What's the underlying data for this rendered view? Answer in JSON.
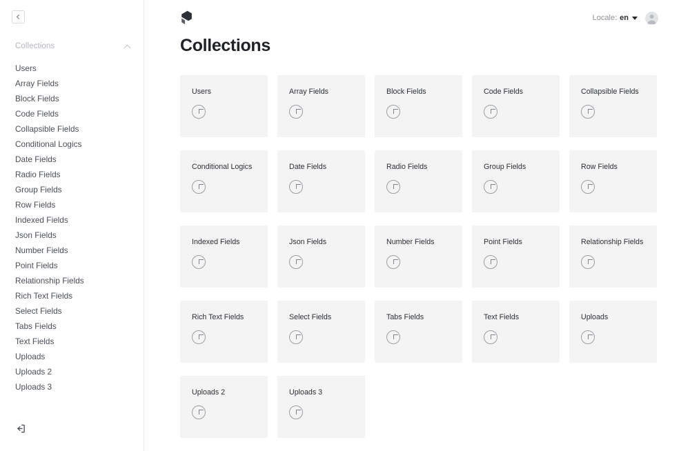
{
  "sidebar": {
    "collapse_button_label": "‹",
    "group": {
      "title": "Collections",
      "expanded": true,
      "toggle_icon": "chevron-up-icon"
    },
    "items": [
      {
        "label": "Users"
      },
      {
        "label": "Array Fields"
      },
      {
        "label": "Block Fields"
      },
      {
        "label": "Code Fields"
      },
      {
        "label": "Collapsible Fields"
      },
      {
        "label": "Conditional Logics"
      },
      {
        "label": "Date Fields"
      },
      {
        "label": "Radio Fields"
      },
      {
        "label": "Group Fields"
      },
      {
        "label": "Row Fields"
      },
      {
        "label": "Indexed Fields"
      },
      {
        "label": "Json Fields"
      },
      {
        "label": "Number Fields"
      },
      {
        "label": "Point Fields"
      },
      {
        "label": "Relationship Fields"
      },
      {
        "label": "Rich Text Fields"
      },
      {
        "label": "Select Fields"
      },
      {
        "label": "Tabs Fields"
      },
      {
        "label": "Text Fields"
      },
      {
        "label": "Uploads"
      },
      {
        "label": "Uploads 2"
      },
      {
        "label": "Uploads 3"
      }
    ],
    "logout_icon": "logout-icon"
  },
  "header": {
    "logo_icon": "payload-logo-icon",
    "locale_label": "Locale:",
    "locale_value": "en",
    "locale_caret_icon": "chevron-down-icon",
    "avatar_icon": "account-avatar-icon"
  },
  "main": {
    "page_title": "Collections",
    "cards": [
      {
        "title": "Users",
        "add_icon": "plus-icon"
      },
      {
        "title": "Array Fields",
        "add_icon": "plus-icon"
      },
      {
        "title": "Block Fields",
        "add_icon": "plus-icon"
      },
      {
        "title": "Code Fields",
        "add_icon": "plus-icon"
      },
      {
        "title": "Collapsible Fields",
        "add_icon": "plus-icon"
      },
      {
        "title": "Conditional Logics",
        "add_icon": "plus-icon"
      },
      {
        "title": "Date Fields",
        "add_icon": "plus-icon"
      },
      {
        "title": "Radio Fields",
        "add_icon": "plus-icon"
      },
      {
        "title": "Group Fields",
        "add_icon": "plus-icon"
      },
      {
        "title": "Row Fields",
        "add_icon": "plus-icon"
      },
      {
        "title": "Indexed Fields",
        "add_icon": "plus-icon"
      },
      {
        "title": "Json Fields",
        "add_icon": "plus-icon"
      },
      {
        "title": "Number Fields",
        "add_icon": "plus-icon"
      },
      {
        "title": "Point Fields",
        "add_icon": "plus-icon"
      },
      {
        "title": "Relationship Fields",
        "add_icon": "plus-icon"
      },
      {
        "title": "Rich Text Fields",
        "add_icon": "plus-icon"
      },
      {
        "title": "Select Fields",
        "add_icon": "plus-icon"
      },
      {
        "title": "Tabs Fields",
        "add_icon": "plus-icon"
      },
      {
        "title": "Text Fields",
        "add_icon": "plus-icon"
      },
      {
        "title": "Uploads",
        "add_icon": "plus-icon"
      },
      {
        "title": "Uploads 2",
        "add_icon": "plus-icon"
      },
      {
        "title": "Uploads 3",
        "add_icon": "plus-icon"
      }
    ]
  },
  "colors": {
    "page_background": "#ffffff",
    "card_background": "#f4f4f4",
    "sidebar_border": "#ebebeb",
    "text_primary": "#2c3036",
    "text_muted": "#b4b8bd",
    "icon_outline": "#9a9fa5"
  }
}
